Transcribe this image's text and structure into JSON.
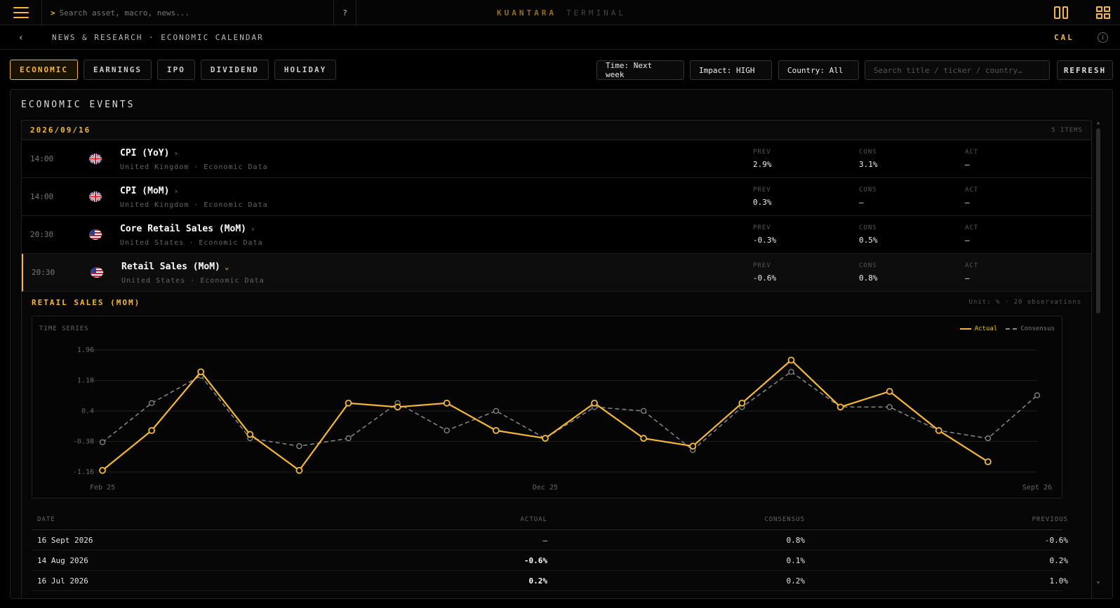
{
  "topbar": {
    "search_prompt": ">",
    "search_placeholder": "Search asset, macro, news...",
    "help_label": "?",
    "brand_primary": "KUANTARA",
    "brand_secondary": "TERMINAL",
    "accent_color": "#f5b83a"
  },
  "breadcrumb": {
    "back_label": "‹",
    "path": "NEWS & RESEARCH · ECONOMIC CALENDAR",
    "right_label": "CAL",
    "info_label": "i"
  },
  "tabs": [
    {
      "label": "ECONOMIC",
      "active": true
    },
    {
      "label": "EARNINGS",
      "active": false
    },
    {
      "label": "IPO",
      "active": false
    },
    {
      "label": "DIVIDEND",
      "active": false
    },
    {
      "label": "HOLIDAY",
      "active": false
    }
  ],
  "filters": {
    "time": "Time: Next week",
    "impact": "Impact: HIGH",
    "country": "Country: All",
    "search_placeholder": "Search title / ticker / country…",
    "refresh_label": "REFRESH"
  },
  "panel": {
    "title": "ECONOMIC EVENTS",
    "date": "2026/09/16",
    "count": "5 ITEMS"
  },
  "events": [
    {
      "time": "14:00",
      "flag": "uk-flag-icon",
      "title": "CPI (YoY)",
      "chevron": "›",
      "subtitle": "United Kingdom · Economic Data",
      "prev_label": "PREV",
      "prev": "2.9%",
      "cons_label": "CONS",
      "cons": "3.1%",
      "act_label": "ACT",
      "act": "—"
    },
    {
      "time": "14:00",
      "flag": "uk-flag-icon",
      "title": "CPI (MoM)",
      "chevron": "›",
      "subtitle": "United Kingdom · Economic Data",
      "prev_label": "PREV",
      "prev": "0.3%",
      "cons_label": "CONS",
      "cons": "—",
      "act_label": "ACT",
      "act": "—"
    },
    {
      "time": "20:30",
      "flag": "us-flag-icon",
      "title": "Core Retail Sales (MoM)",
      "chevron": "›",
      "subtitle": "United States · Economic Data",
      "prev_label": "PREV",
      "prev": "-0.3%",
      "cons_label": "CONS",
      "cons": "0.5%",
      "act_label": "ACT",
      "act": "—"
    },
    {
      "time": "20:30",
      "flag": "us-flag-icon",
      "title": "Retail Sales (MoM)",
      "chevron": "⌄",
      "subtitle": "United States · Economic Data",
      "prev_label": "PREV",
      "prev": "-0.6%",
      "cons_label": "CONS",
      "cons": "0.8%",
      "act_label": "ACT",
      "act": "—"
    }
  ],
  "detail": {
    "title": "RETAIL SALES (MOM)",
    "meta": "Unit: % · 20 observations",
    "series_label": "TIME SERIES",
    "legend_actual": "Actual",
    "legend_consensus": "Consensus"
  },
  "chart_data": {
    "type": "line",
    "title": "",
    "xlabel": "",
    "ylabel": "",
    "ylim": [
      -1.16,
      1.96
    ],
    "yticks": [
      "1.96",
      "1.18",
      "0.4",
      "-0.38",
      "-1.16"
    ],
    "xtick_labels": [
      {
        "label": "Feb 25",
        "index": 0
      },
      {
        "label": "Dec 25",
        "index": 9
      },
      {
        "label": "Sept 26",
        "index": 19
      }
    ],
    "grid": true,
    "legend": "top-right",
    "series": [
      {
        "name": "Actual",
        "color": "#f5b83a",
        "dashed": false,
        "values": [
          -1.12,
          -0.1,
          1.4,
          -0.2,
          -1.12,
          0.6,
          0.5,
          0.6,
          -0.1,
          -0.3,
          0.6,
          -0.3,
          -0.5,
          0.6,
          1.7,
          0.5,
          0.9,
          -0.1,
          -0.9,
          null
        ]
      },
      {
        "name": "Consensus",
        "color": "#8a8a8a",
        "dashed": true,
        "values": [
          -0.4,
          0.6,
          1.3,
          -0.3,
          -0.5,
          -0.3,
          0.6,
          -0.1,
          0.4,
          -0.3,
          0.5,
          0.4,
          -0.6,
          0.5,
          1.4,
          0.5,
          0.5,
          -0.1,
          -0.3,
          0.8
        ]
      }
    ]
  },
  "history": {
    "headers": {
      "date": "DATE",
      "actual": "ACTUAL",
      "consensus": "CONSENSUS",
      "previous": "PREVIOUS"
    },
    "rows": [
      {
        "date": "16 Sept 2026",
        "actual": "—",
        "consensus": "0.8%",
        "previous": "-0.6%"
      },
      {
        "date": "14 Aug 2026",
        "actual": "-0.6%",
        "consensus": "0.1%",
        "previous": "0.2%"
      },
      {
        "date": "16 Jul 2026",
        "actual": "0.2%",
        "consensus": "0.2%",
        "previous": "1.0%"
      }
    ]
  },
  "scroll": {
    "up": "▲",
    "down": "▼"
  }
}
